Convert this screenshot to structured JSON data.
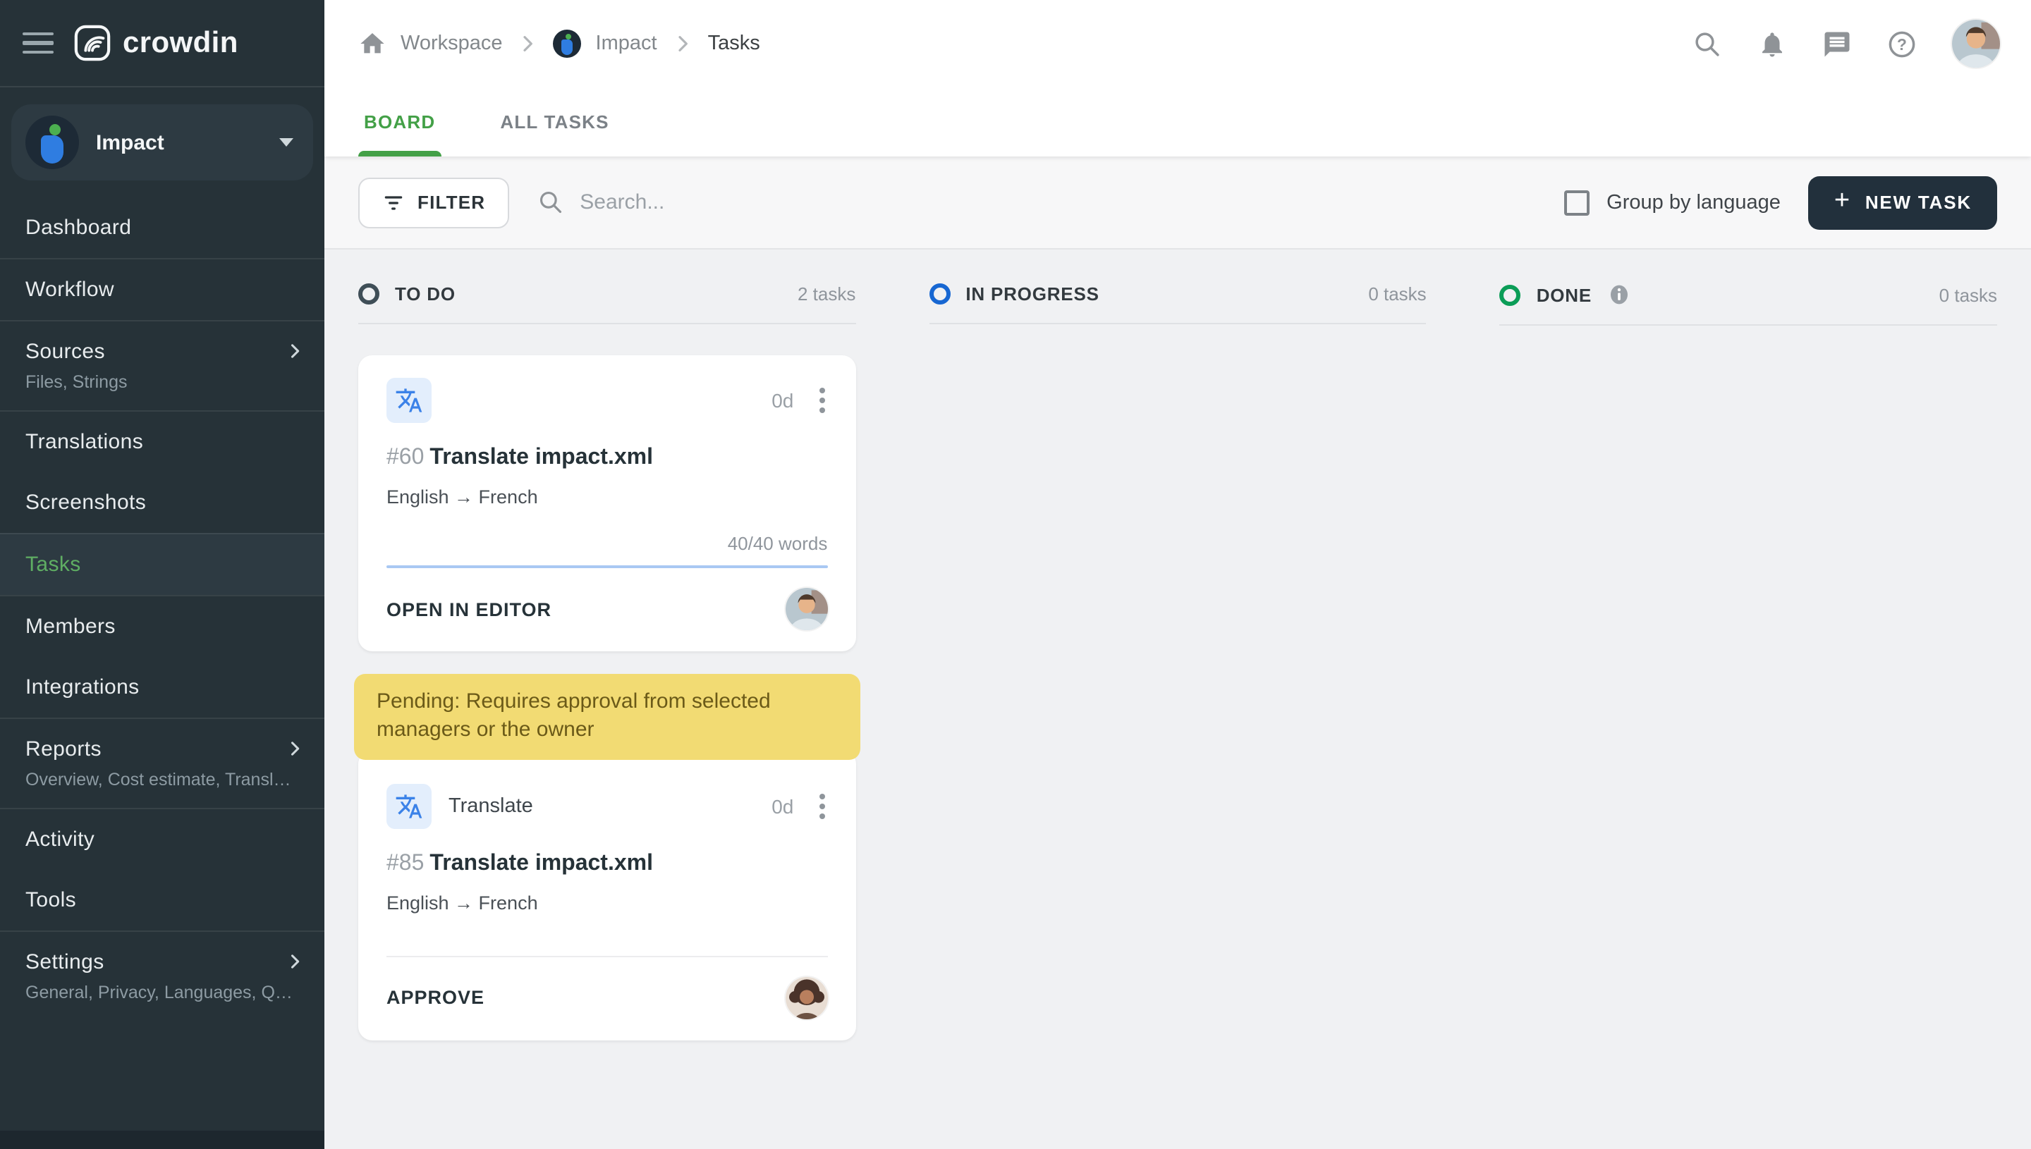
{
  "theme": {
    "sidebar_bg": "#263238",
    "green": "#43a047",
    "task_green": "#5fae63",
    "banner_bg": "#f2db73",
    "banner_text": "#6b5a18",
    "progress": "#a9c8f3",
    "new_task_bg": "#22303c",
    "todo_color": "#3f4e57",
    "in_progress_color": "#1767d2",
    "done_color": "#0b9d57"
  },
  "app": {
    "name": "crowdin"
  },
  "sidebar": {
    "project": {
      "name": "Impact"
    },
    "items": [
      {
        "label": "Dashboard"
      },
      {
        "label": "Workflow"
      },
      {
        "label": "Sources",
        "sublabel": "Files, Strings"
      },
      {
        "label": "Translations"
      },
      {
        "label": "Screenshots"
      },
      {
        "label": "Tasks"
      },
      {
        "label": "Members"
      },
      {
        "label": "Integrations"
      },
      {
        "label": "Reports",
        "sublabel": "Overview, Cost estimate, Transl…"
      },
      {
        "label": "Activity"
      },
      {
        "label": "Tools"
      },
      {
        "label": "Settings",
        "sublabel": "General, Privacy, Languages, Q…"
      }
    ]
  },
  "header": {
    "breadcrumb": {
      "workspace": "Workspace",
      "project": "Impact",
      "page": "Tasks"
    }
  },
  "tabs": {
    "board": "BOARD",
    "all_tasks": "ALL TASKS"
  },
  "toolbar": {
    "filter": "FILTER",
    "search_placeholder": "Search...",
    "group_by": "Group by language",
    "new_task": "NEW TASK",
    "new_task_plus": "+"
  },
  "board": {
    "columns": [
      {
        "label": "TO DO",
        "count": "2 tasks",
        "cards": [
          {
            "duration": "0d",
            "id": "#60",
            "title": "Translate impact.xml",
            "languages": "English → French",
            "words": "40/40 words",
            "progress_pct": 100,
            "action": "OPEN IN EDITOR"
          },
          {
            "banner": "Pending: Requires approval from selected managers or the owner",
            "type": "Translate",
            "duration": "0d",
            "id": "#85",
            "title": "Translate impact.xml",
            "languages": "English → French",
            "action": "APPROVE"
          }
        ]
      },
      {
        "label": "IN PROGRESS",
        "count": "0 tasks",
        "cards": []
      },
      {
        "label": "DONE",
        "count": "0 tasks",
        "cards": []
      }
    ]
  }
}
